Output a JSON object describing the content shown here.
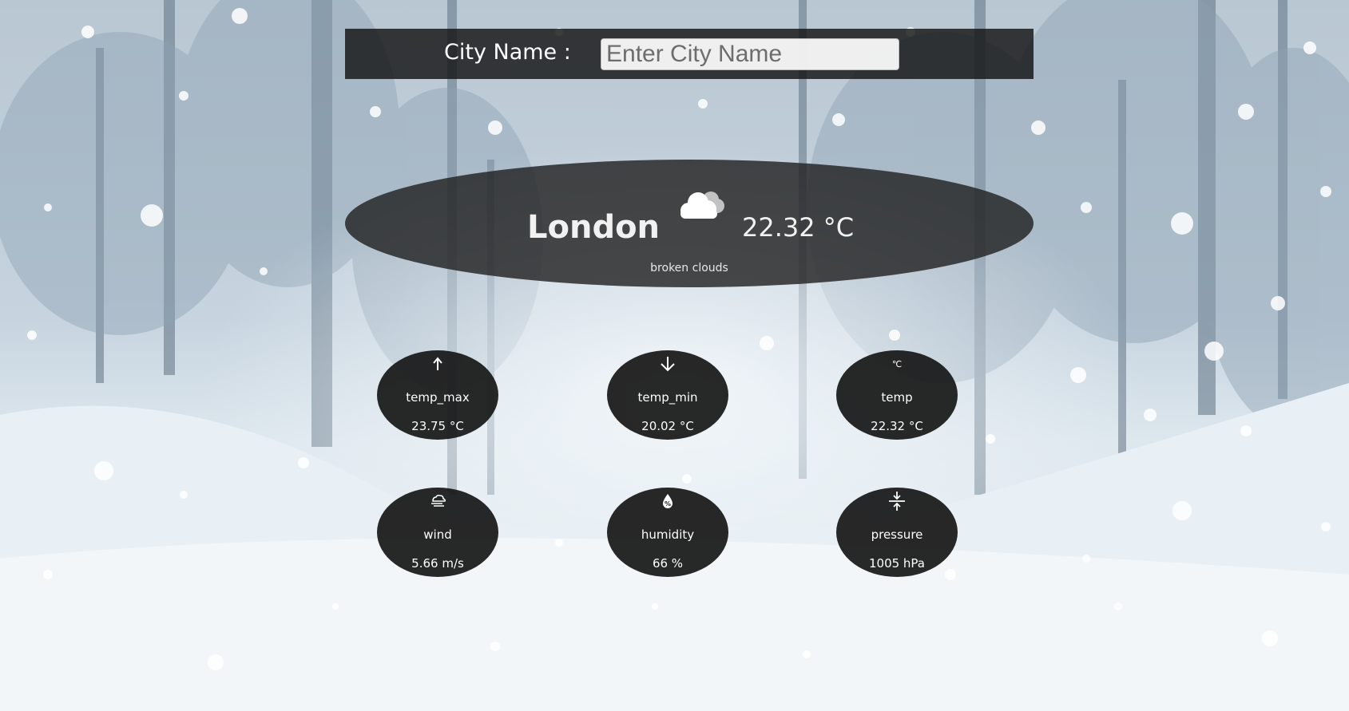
{
  "search": {
    "label": "City Name :",
    "placeholder": "Enter City Name",
    "value": ""
  },
  "current": {
    "city": "London",
    "temperature": "22.32 °C",
    "description": "broken clouds",
    "icon": "cloud-icon"
  },
  "stats": [
    {
      "label": "temp_max",
      "value": "23.75 °C",
      "icon": "arrow-up-icon"
    },
    {
      "label": "temp_min",
      "value": "20.02 °C",
      "icon": "arrow-down-icon"
    },
    {
      "label": "temp",
      "value": "22.32 °C",
      "icon": "celsius-icon",
      "glyph": "℃"
    },
    {
      "label": "wind",
      "value": "5.66 m/s",
      "icon": "wind-cloud-icon"
    },
    {
      "label": "humidity",
      "value": "66 %",
      "icon": "humidity-drop-icon",
      "glyph": "%"
    },
    {
      "label": "pressure",
      "value": "1005 hPa",
      "icon": "pressure-icon"
    }
  ],
  "colors": {
    "panel": "#222222",
    "text": "#ffffff",
    "background": "#a9bccd"
  }
}
